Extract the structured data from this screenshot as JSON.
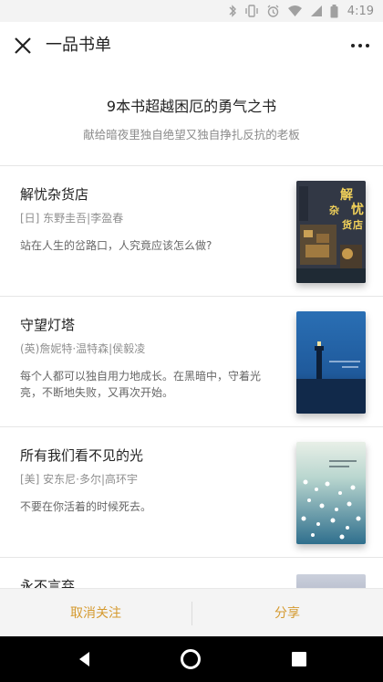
{
  "status_bar": {
    "time": "4:19",
    "icons": [
      "bluetooth-icon",
      "vibrate-icon",
      "alarm-icon",
      "wifi-icon",
      "signal-icon",
      "battery-icon"
    ]
  },
  "title_bar": {
    "title": "一品书单",
    "close_icon": "close-icon",
    "more_icon": "more-icon"
  },
  "hero": {
    "title": "9本书超越困厄的勇气之书",
    "subtitle": "献给暗夜里独自绝望又独自挣扎反抗的老板"
  },
  "books": [
    {
      "title": "解忧杂货店",
      "author": "[日] 东野圭吾|李盈春",
      "desc": "站在人生的岔路口，人究竟应该怎么做?",
      "cover_text": "解忧杂货店"
    },
    {
      "title": "守望灯塔",
      "author": "(英)詹妮特·温特森|侯毅凌",
      "desc": "每个人都可以独自用力地成长。在黑暗中，守着光亮，不断地失败，又再次开始。"
    },
    {
      "title": "所有我们看不见的光",
      "author": "[美] 安东尼·多尔|高环宇",
      "desc": "不要在你活着的时候死去。"
    },
    {
      "title": "永不言弃"
    }
  ],
  "bottom_bar": {
    "unfollow": "取消关注",
    "share": "分享"
  },
  "colors": {
    "accent": "#d59a2f"
  }
}
